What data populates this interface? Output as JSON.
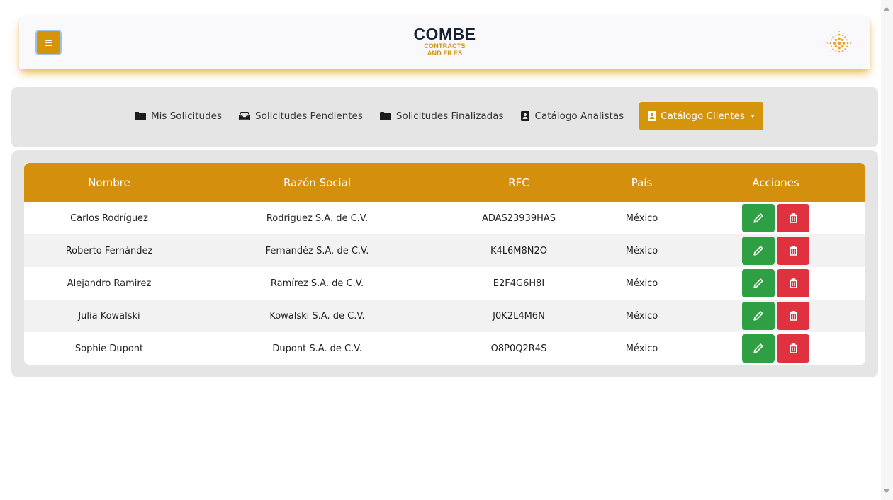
{
  "header": {
    "logo_title": "COMBE",
    "logo_line1": "CONTRACTS",
    "logo_line2": "AND FILES"
  },
  "nav": {
    "items": [
      {
        "label": "Mis Solicitudes",
        "icon": "folder-icon"
      },
      {
        "label": "Solicitudes Pendientes",
        "icon": "inbox-icon"
      },
      {
        "label": "Solicitudes Finalizadas",
        "icon": "folder-icon"
      },
      {
        "label": "Catálogo Analistas",
        "icon": "contact-book-icon"
      },
      {
        "label": "Catálogo Clientes",
        "icon": "contact-book-icon",
        "active": true
      }
    ]
  },
  "table": {
    "headers": [
      "Nombre",
      "Razón Social",
      "RFC",
      "País",
      "Acciones"
    ],
    "rows": [
      {
        "nombre": "Carlos Rodríguez",
        "razon": "Rodriguez S.A. de C.V.",
        "rfc": "ADAS23939HAS",
        "pais": "México"
      },
      {
        "nombre": "Roberto Fernández",
        "razon": "Fernandéz S.A. de C.V.",
        "rfc": "K4L6M8N2O",
        "pais": "México"
      },
      {
        "nombre": "Alejandro Ramirez",
        "razon": "Ramírez S.A. de C.V.",
        "rfc": "E2F4G6H8I",
        "pais": "México"
      },
      {
        "nombre": "Julia Kowalski",
        "razon": "Kowalski S.A. de C.V.",
        "rfc": "J0K2L4M6N",
        "pais": "México"
      },
      {
        "nombre": "Sophie Dupont",
        "razon": "Dupont S.A. de C.V.",
        "rfc": "O8P0Q2R4S",
        "pais": "México"
      }
    ]
  },
  "colors": {
    "accent": "#d4950c",
    "edit": "#2ea043",
    "delete": "#e0313f"
  }
}
